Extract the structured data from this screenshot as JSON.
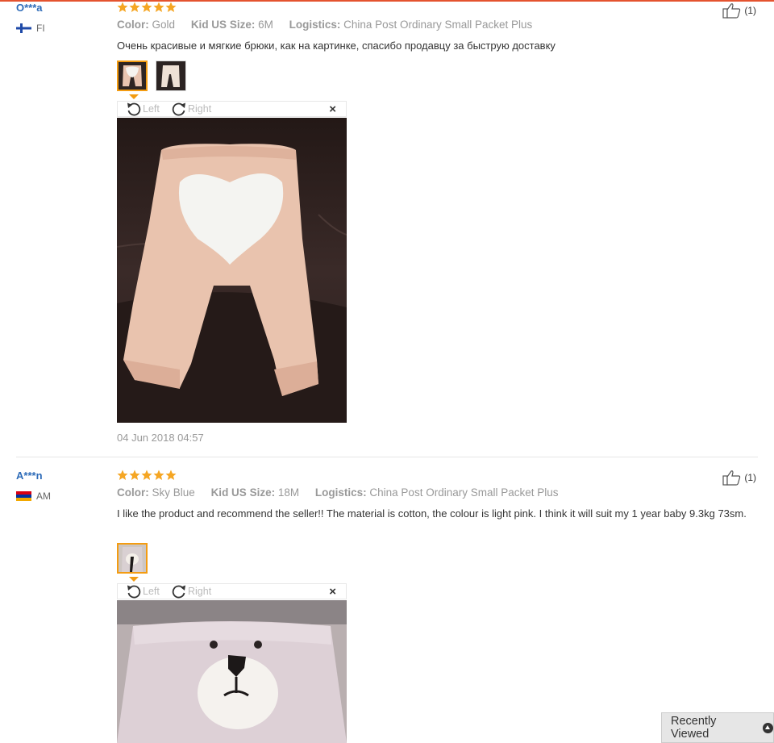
{
  "reviews": [
    {
      "user": "O***a",
      "country": "FI",
      "rating": 5,
      "color_label": "Color:",
      "color": "Gold",
      "size_label": "Kid US Size:",
      "size": "6M",
      "logistics_label": "Logistics:",
      "logistics": "China Post Ordinary Small Packet Plus",
      "text": "Очень красивые и мягкие брюки, как на картинке, спасибо продавцу за быструю доставку",
      "viewer": {
        "left": "Left",
        "right": "Right",
        "close": "×"
      },
      "date": "04 Jun 2018 04:57",
      "helpful": "(1)"
    },
    {
      "user": "A***n",
      "country": "AM",
      "rating": 5,
      "color_label": "Color:",
      "color": "Sky Blue",
      "size_label": "Kid US Size:",
      "size": "18M",
      "logistics_label": "Logistics:",
      "logistics": "China Post Ordinary Small Packet Plus",
      "text": "I like the product and recommend the seller!! The material is cotton, the colour is light pink. I think it will suit my 1 year baby 9.3kg 73sm.",
      "viewer": {
        "left": "Left",
        "right": "Right",
        "close": "×"
      },
      "helpful": "(1)"
    }
  ],
  "recently_viewed": "Recently Viewed",
  "colors": {
    "accent": "#f39c12",
    "link": "#2d6bb8",
    "star": "#f5a623"
  }
}
